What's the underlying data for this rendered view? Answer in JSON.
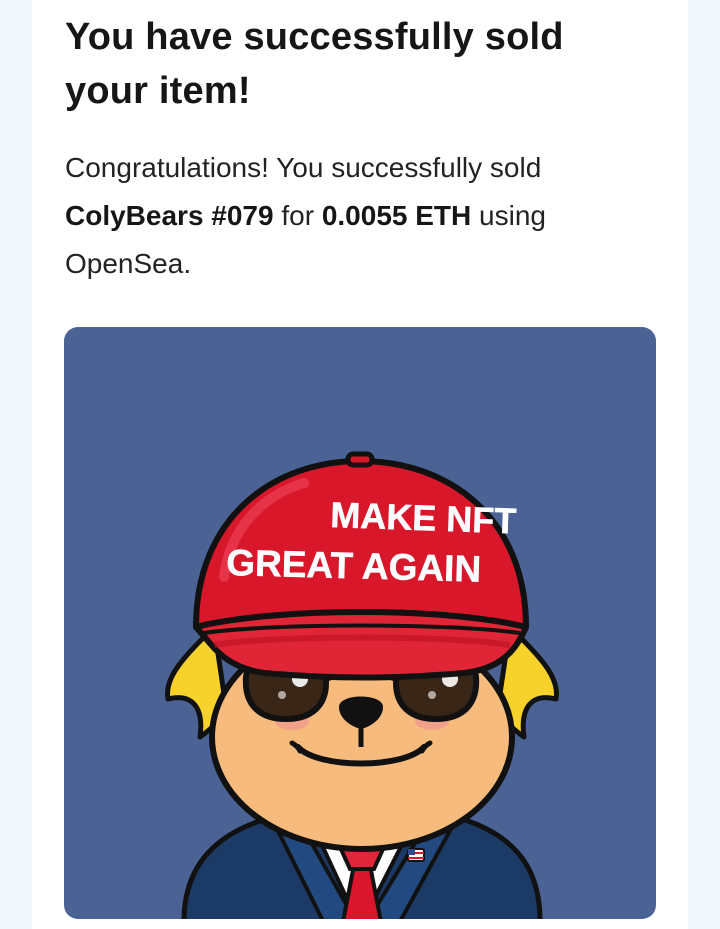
{
  "email": {
    "title": "You have successfully sold your item!",
    "message": {
      "intro": "Congratulations! You successfully sold",
      "item_name": "ColyBears #079",
      "for_word": "for",
      "price": "0.0055 ETH",
      "using_word": "using",
      "marketplace": "OpenSea."
    },
    "nft_image": {
      "alt": "ColyBears #079",
      "hat_line1": "MAKE NFT",
      "hat_line2": "GREAT AGAIN",
      "background_color": "#4a6394"
    }
  }
}
